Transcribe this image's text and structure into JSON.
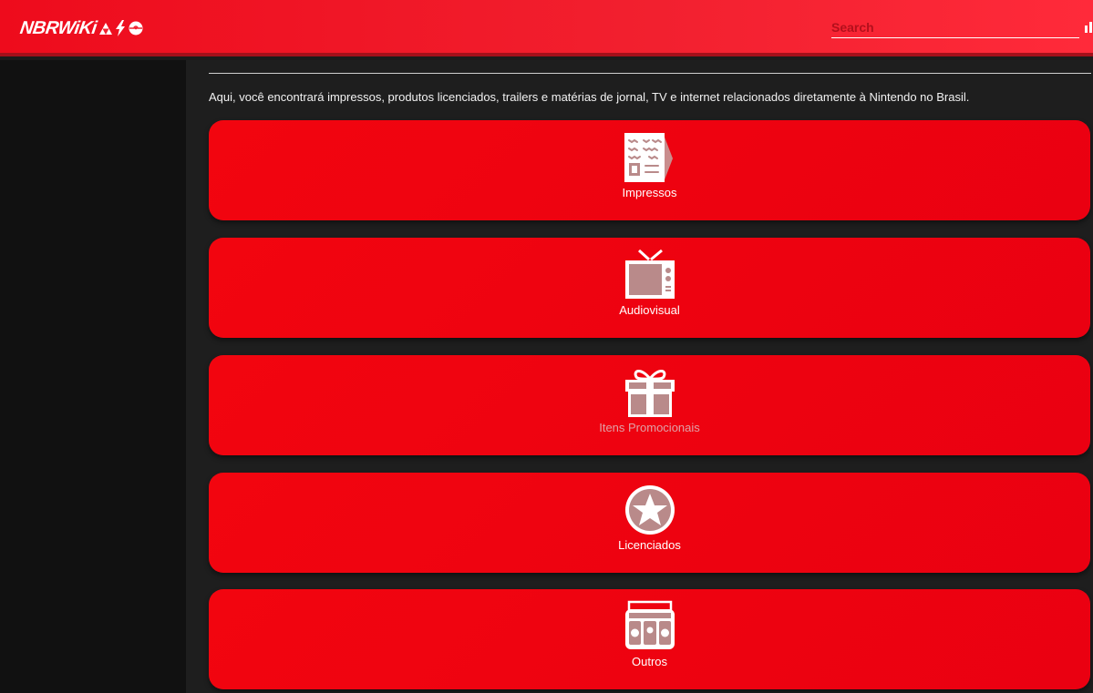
{
  "header": {
    "logo_text": "NBRWiKi",
    "search_placeholder": "Search"
  },
  "intro_text": "Aqui, você encontrará impressos, produtos licenciados, trailers e matérias de jornal, TV e internet relacionados diretamente à Nintendo no Brasil.",
  "categories": [
    {
      "label": "Impressos",
      "icon": "newspaper-icon"
    },
    {
      "label": "Audiovisual",
      "icon": "tv-icon"
    },
    {
      "label": "Itens Promocionais",
      "icon": "gift-icon"
    },
    {
      "label": "Licenciados",
      "icon": "star-badge-icon"
    },
    {
      "label": "Outros",
      "icon": "radio-icon"
    }
  ],
  "colors": {
    "header_red": "#f2202f",
    "card_red": "#ee0010",
    "icon_fill": "#b98a8a",
    "background": "#1e1e1e",
    "sidebar": "#111111"
  }
}
